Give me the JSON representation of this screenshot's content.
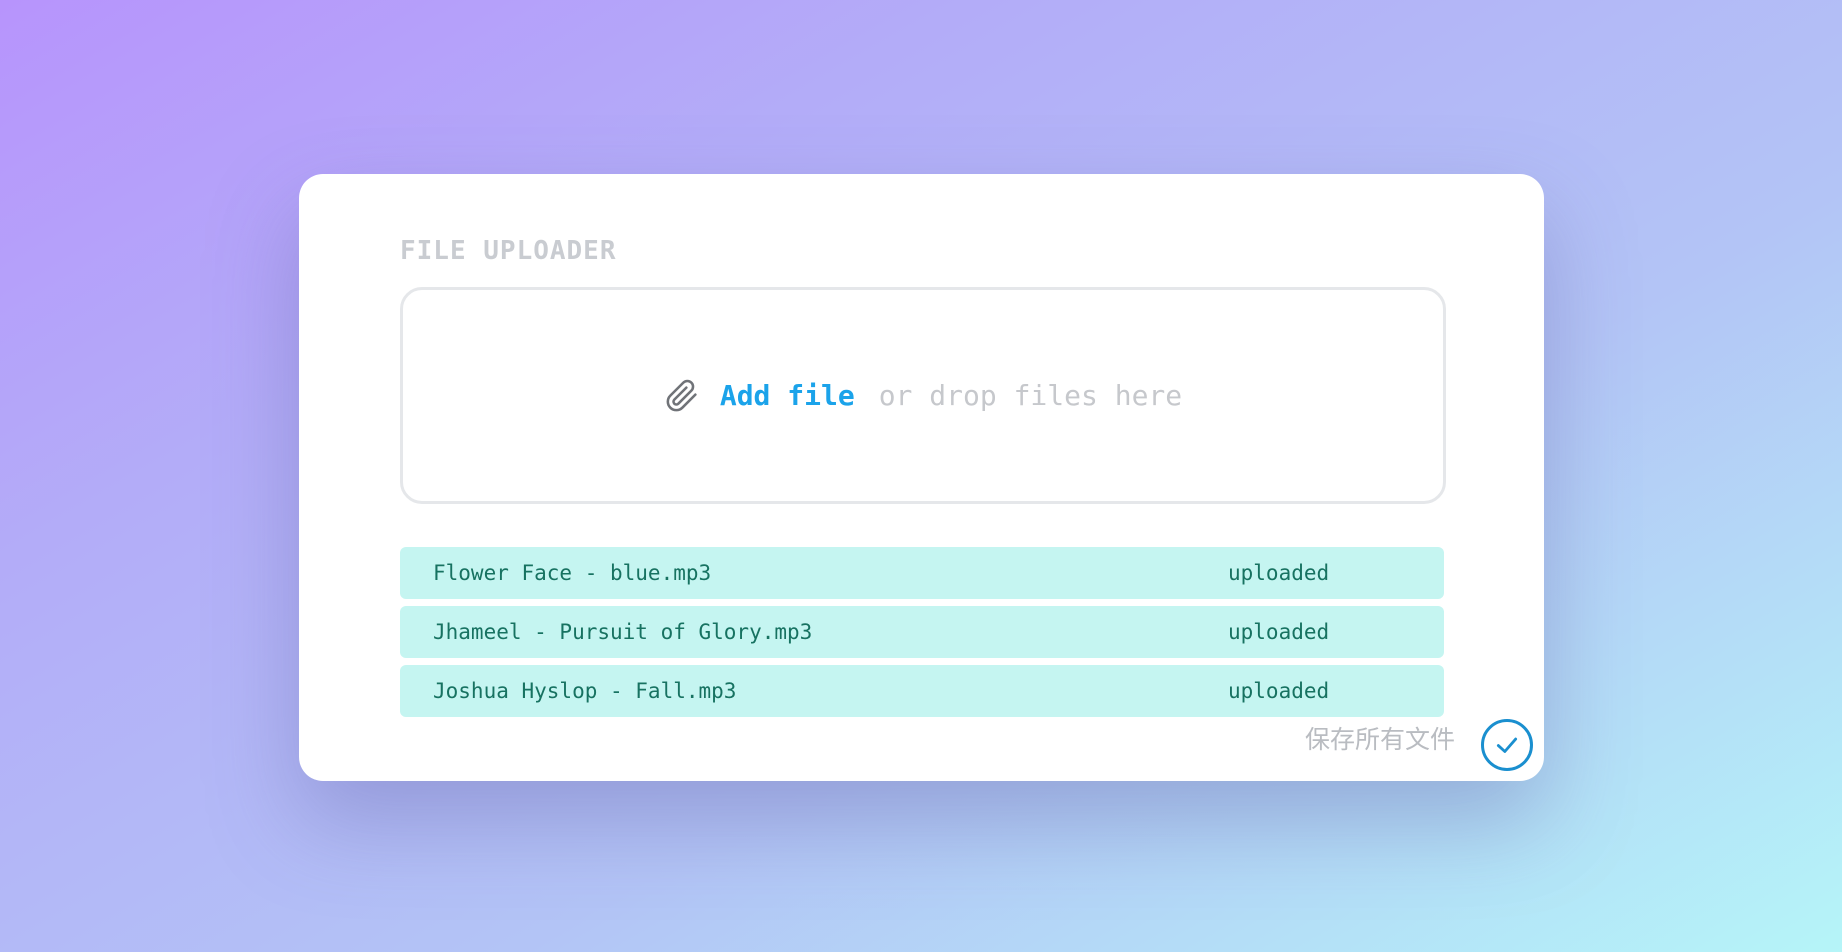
{
  "uploader": {
    "title": "FILE UPLOADER",
    "add_file_label": "Add file",
    "drop_hint": "or drop files here"
  },
  "files": [
    {
      "name": "Flower Face - blue.mp3",
      "status": "uploaded"
    },
    {
      "name": "Jhameel - Pursuit of Glory.mp3",
      "status": "uploaded"
    },
    {
      "name": "Joshua Hyslop - Fall.mp3",
      "status": "uploaded"
    }
  ],
  "footer": {
    "save_all_label": "保存所有文件"
  },
  "icons": {
    "attach": "paperclip-icon",
    "save": "check-circle-icon"
  },
  "colors": {
    "accent": "#1ba3ea",
    "file_row_bg": "#c5f5f1",
    "file_text": "#177261",
    "save_button": "#1a8fcf"
  }
}
